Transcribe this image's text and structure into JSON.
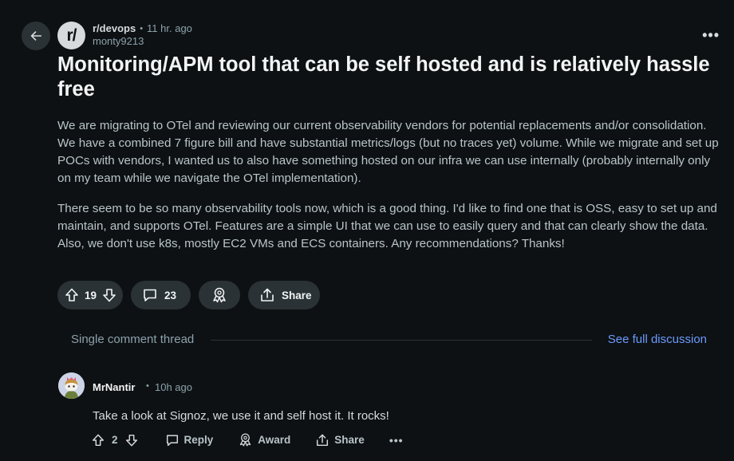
{
  "post": {
    "subreddit": "r/devops",
    "subreddit_icon_text": "r/",
    "time": "11 hr. ago",
    "author": "monty9213",
    "title": "Monitoring/APM tool that can be self hosted and is relatively hassle free",
    "body": [
      "We are migrating to OTel and reviewing our current observability vendors for potential replacements and/or consolidation. We have a combined 7 figure bill and have substantial metrics/logs (but no traces yet) volume. While we migrate and set up POCs with vendors, I wanted us to also have something hosted on our infra we can use internally (probably internally only on my team while we navigate the OTel implementation).",
      "There seem to be so many observability tools now, which is a good thing. I'd like to find one that is OSS, easy to set up and maintain, and supports OTel. Features are a simple UI that we can use to easily query and that can clearly show the data. Also, we don't use k8s, mostly EC2 VMs and ECS containers. Any recommendations? Thanks!"
    ],
    "votes": "19",
    "comments": "23",
    "share_label": "Share"
  },
  "thread": {
    "label": "Single comment thread",
    "full_link": "See full discussion"
  },
  "comment": {
    "author": "MrNantir",
    "time": "10h ago",
    "text": "Take a look at Signoz, we use it and self host it. It rocks!",
    "votes": "2",
    "reply_label": "Reply",
    "award_label": "Award",
    "share_label": "Share"
  },
  "icons": {
    "back": "arrow-left-icon",
    "more": "ellipsis-icon",
    "upvote": "arrow-up-icon",
    "downvote": "arrow-down-icon",
    "comment": "speech-bubble-icon",
    "award": "award-ribbon-icon",
    "share": "share-upload-icon"
  },
  "colors": {
    "background": "#0e1113",
    "button": "#2a3236",
    "link": "#6a9bff",
    "muted": "#8ba2ad"
  }
}
